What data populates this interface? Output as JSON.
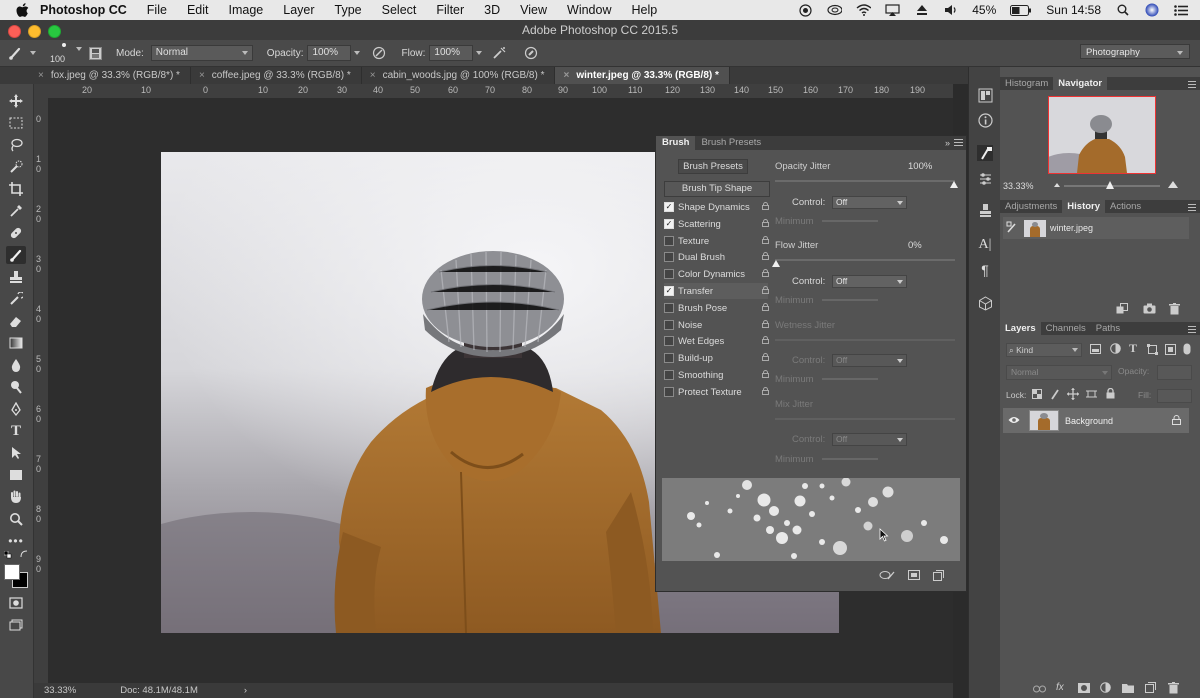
{
  "menubar": {
    "app": "Photoshop CC",
    "items": [
      "File",
      "Edit",
      "Image",
      "Layer",
      "Type",
      "Select",
      "Filter",
      "3D",
      "View",
      "Window",
      "Help"
    ],
    "battery": "45%",
    "clock": "Sun 14:58"
  },
  "window": {
    "title": "Adobe Photoshop CC 2015.5"
  },
  "options": {
    "brush_size": "100",
    "mode_label": "Mode:",
    "mode_value": "Normal",
    "opacity_label": "Opacity:",
    "opacity_value": "100%",
    "flow_label": "Flow:",
    "flow_value": "100%",
    "workspace": "Photography"
  },
  "tabs": [
    {
      "label": "fox.jpeg @ 33.3% (RGB/8*) *"
    },
    {
      "label": "coffee.jpeg @ 33.3% (RGB/8) *"
    },
    {
      "label": "cabin_woods.jpg @ 100% (RGB/8) *"
    },
    {
      "label": "winter.jpeg @ 33.3% (RGB/8) *"
    }
  ],
  "ruler_h": [
    "20",
    "10",
    "0",
    "10",
    "20",
    "30",
    "40",
    "50",
    "60",
    "70",
    "80",
    "90",
    "100",
    "110",
    "120",
    "130",
    "140",
    "150",
    "160",
    "170",
    "180",
    "190"
  ],
  "ruler_v": [
    "0",
    "1",
    "0",
    "2",
    "0",
    "3",
    "0",
    "4",
    "0",
    "5",
    "0",
    "6",
    "0",
    "7",
    "0",
    "8",
    "0",
    "9",
    "0"
  ],
  "status": {
    "zoom": "33.33%",
    "doc": "Doc: 48.1M/48.1M"
  },
  "brush_panel": {
    "tabs": [
      "Brush",
      "Brush Presets"
    ],
    "presets_button": "Brush Presets",
    "tip_shape": "Brush Tip Shape",
    "options": [
      {
        "label": "Shape Dynamics",
        "checked": true
      },
      {
        "label": "Scattering",
        "checked": true
      },
      {
        "label": "Texture",
        "checked": false
      },
      {
        "label": "Dual Brush",
        "checked": false
      },
      {
        "label": "Color Dynamics",
        "checked": false
      },
      {
        "label": "Transfer",
        "checked": true
      },
      {
        "label": "Brush Pose",
        "checked": false
      },
      {
        "label": "Noise",
        "checked": false
      },
      {
        "label": "Wet Edges",
        "checked": false
      },
      {
        "label": "Build-up",
        "checked": false
      },
      {
        "label": "Smoothing",
        "checked": false
      },
      {
        "label": "Protect Texture",
        "checked": false
      }
    ],
    "opacity_jitter_label": "Opacity Jitter",
    "opacity_jitter_value": "100%",
    "control_label": "Control:",
    "control_value": "Off",
    "minimum_label": "Minimum",
    "flow_jitter_label": "Flow Jitter",
    "flow_jitter_value": "0%",
    "wetness_jitter_label": "Wetness Jitter",
    "mix_jitter_label": "Mix Jitter"
  },
  "navigator": {
    "tabs": [
      "Histogram",
      "Navigator"
    ],
    "zoom": "33.33%"
  },
  "history": {
    "tabs": [
      "Adjustments",
      "History",
      "Actions"
    ],
    "item": "winter.jpeg"
  },
  "layers": {
    "tabs": [
      "Layers",
      "Channels",
      "Paths"
    ],
    "kind": "Kind",
    "blend": "Normal",
    "opacity_label": "Opacity:",
    "lock_label": "Lock:",
    "fill_label": "Fill:",
    "layer_name": "Background"
  }
}
